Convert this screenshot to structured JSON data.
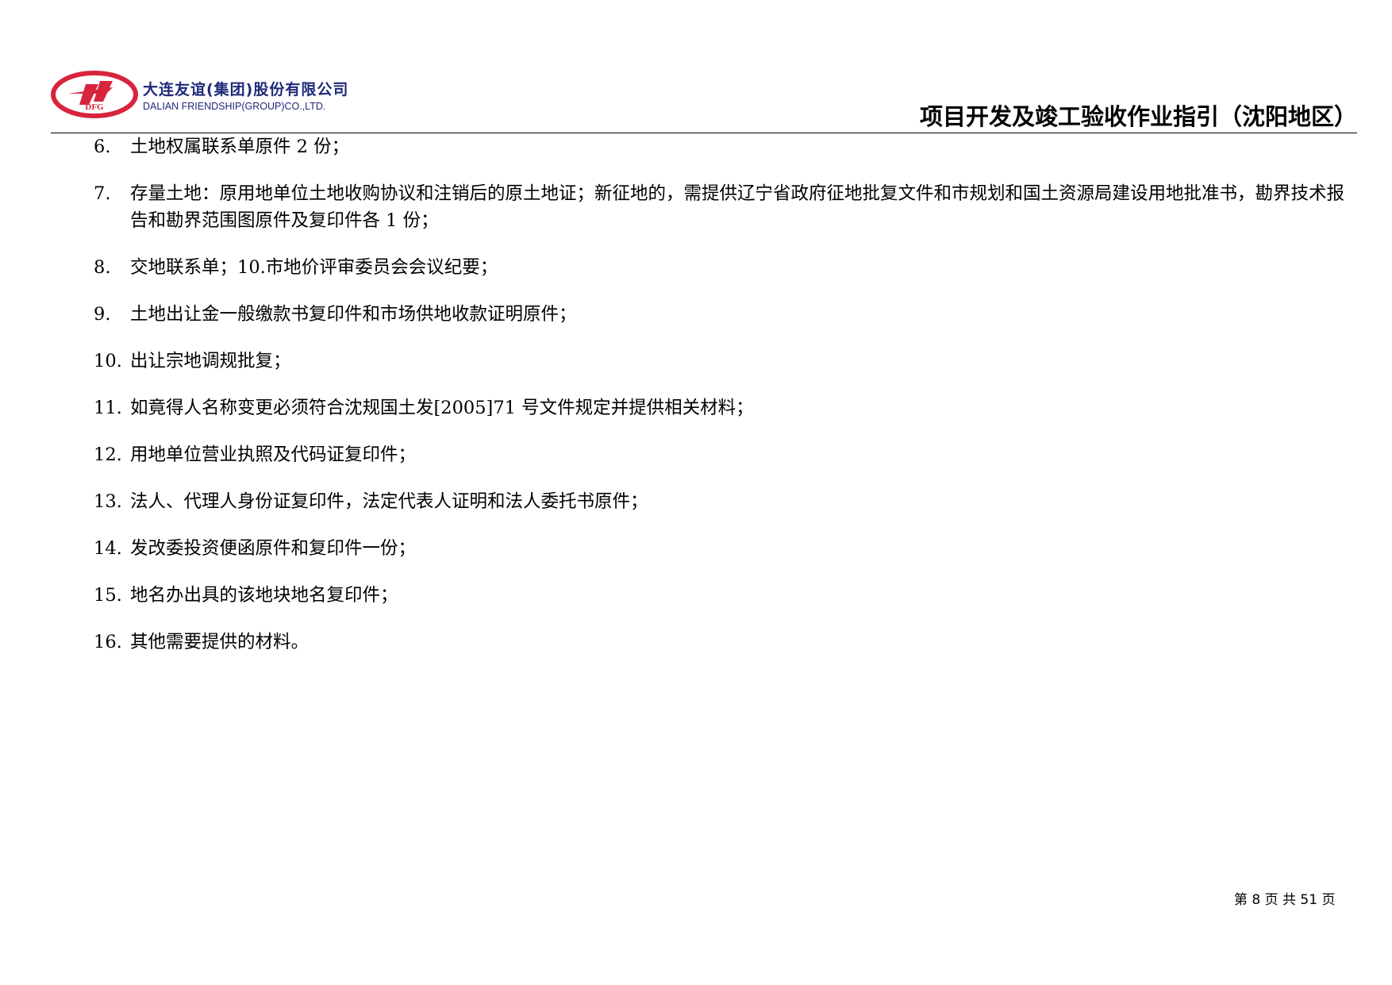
{
  "header": {
    "company_cn": "大连友谊(集团)股份有限公司",
    "company_en": "DALIAN FRIENDSHIP(GROUP)CO.,LTD.",
    "emblem_text": "DFG",
    "doc_title": "项目开发及竣工验收作业指引（沈阳地区）"
  },
  "items": [
    {
      "num": "6.",
      "text": "土地权属联系单原件 2 份；"
    },
    {
      "num": "7.",
      "text": "存量土地：原用地单位土地收购协议和注销后的原土地证；新征地的，需提供辽宁省政府征地批复文件和市规划和国土资源局建设用地批准书，勘界技术报告和勘界范围图原件及复印件各 1 份；"
    },
    {
      "num": "8.",
      "text": "交地联系单；10.市地价评审委员会会议纪要；"
    },
    {
      "num": "9.",
      "text": "土地出让金一般缴款书复印件和市场供地收款证明原件；"
    },
    {
      "num": "10.",
      "text": "出让宗地调规批复；"
    },
    {
      "num": "11.",
      "text": "如竟得人名称变更必须符合沈规国土发[2005]71 号文件规定并提供相关材料；"
    },
    {
      "num": "12.",
      "text": "用地单位营业执照及代码证复印件；"
    },
    {
      "num": "13.",
      "text": "法人、代理人身份证复印件，法定代表人证明和法人委托书原件；"
    },
    {
      "num": "14.",
      "text": "发改委投资便函原件和复印件一份；"
    },
    {
      "num": "15.",
      "text": "地名办出具的该地块地名复印件；"
    },
    {
      "num": "16.",
      "text": "其他需要提供的材料。"
    }
  ],
  "footer": {
    "page_label": "第 8 页  共 51 页"
  },
  "colors": {
    "logo_red": "#d8243c",
    "logo_blue": "#1e2a78"
  }
}
